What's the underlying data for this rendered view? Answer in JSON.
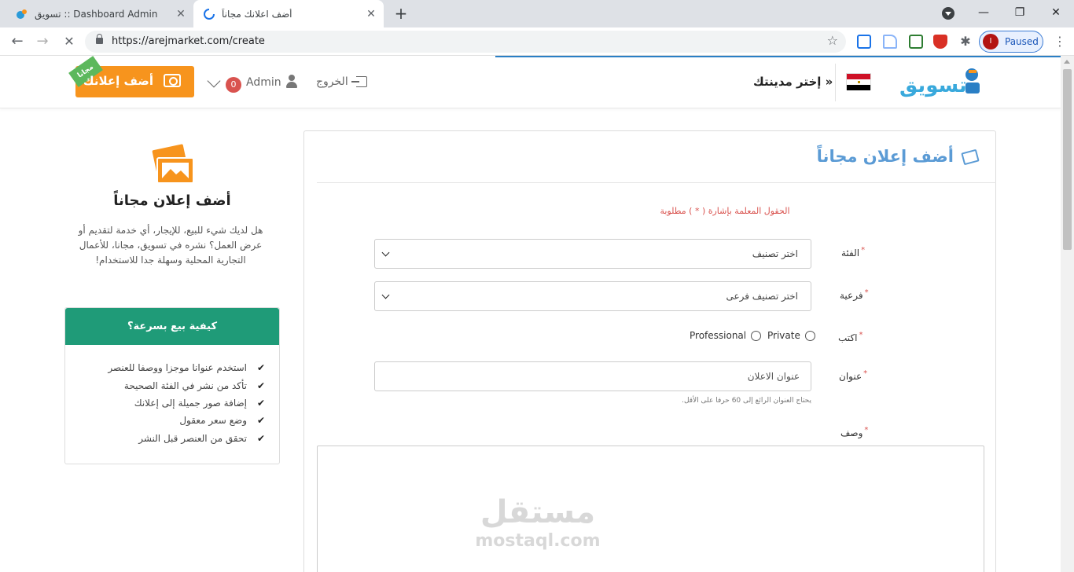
{
  "browser": {
    "tabs": [
      {
        "title": "تسويق :: Dashboard Admin",
        "active": false
      },
      {
        "title": "أضف اعلانك مجاناً",
        "active": true
      }
    ],
    "url": "https://arejmarket.com/create",
    "profile_initial": "I",
    "profile_status": "Paused"
  },
  "header": {
    "add_ad_label": "أضف إعلانك",
    "free_ribbon": "مجانا",
    "notification_count": "0",
    "user_name": "Admin",
    "logout_label": "الخروج",
    "city_label": "إختر مدينتك »",
    "logo_text": "تسويق",
    "accent_color": "#2a7fc5"
  },
  "sidebar": {
    "title": "أضف إعلان مجاناً",
    "description": "هل لديك شيء للبيع، للإيجار، أي خدمة لتقديم أو عرض العمل؟ نشره في تسويق، مجانا، للأعمال التجارية المحلية وسهلة جدا للاستخدام!",
    "tips_title": "كيفية بيع بسرعة؟",
    "tips": [
      "استخدم عنوانا موجزا ووصفا للعنصر",
      "تأكد من نشر في الفئة الصحيحة",
      "إضافة صور جميلة إلى إعلانك",
      "وضع سعر معقول",
      "تحقق من العنصر قبل النشر"
    ]
  },
  "form": {
    "title": "أضف إعلان مجاناً",
    "required_note": "الحقول المعلمة بإشارة ( * ) مطلوبة",
    "category_label": "الفئة",
    "category_value": "اختر تصنيف",
    "subcategory_label": "فرعية",
    "subcategory_value": "اختر تصنيف فرعى",
    "type_label": "اكتب",
    "type_private": "Private",
    "type_professional": "Professional",
    "title_label": "عنوان",
    "title_placeholder": "عنوان الاعلان",
    "title_hint": "يحتاج العنوان الرائع إلى 60 حرفا على الأقل.",
    "description_label": "وصف",
    "required_mark": "*"
  },
  "watermark": {
    "arabic": "مستقل",
    "latin": "mostaql.com"
  }
}
